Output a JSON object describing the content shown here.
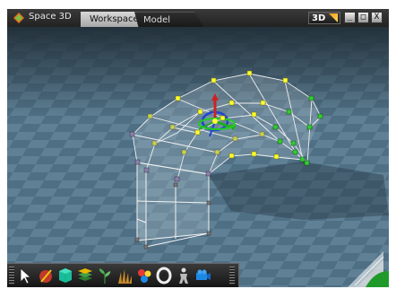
{
  "window": {
    "app_title": "Space 3D"
  },
  "tabs": [
    {
      "label": "Workspace",
      "active": true
    },
    {
      "label": "Model",
      "active": false
    }
  ],
  "view_mode": {
    "label": "3D"
  },
  "window_controls": {
    "minimize": "_",
    "maximize": "□",
    "close": "X"
  },
  "colors": {
    "accent_orange": "#ff9a1a",
    "floor": "#5d7d92",
    "vertex_yellow": "#ffff33",
    "vertex_green": "#33cc33"
  },
  "toolbar": {
    "tools": [
      {
        "icon": "select-arrow-icon"
      },
      {
        "icon": "paint-icon"
      },
      {
        "icon": "cube-tool-icon"
      },
      {
        "icon": "stack-layers-icon"
      },
      {
        "icon": "plant-icon"
      },
      {
        "icon": "grass-icon"
      },
      {
        "icon": "molecule-icon"
      },
      {
        "icon": "torus-icon"
      },
      {
        "icon": "figure-icon"
      },
      {
        "icon": "camera-icon"
      }
    ]
  }
}
